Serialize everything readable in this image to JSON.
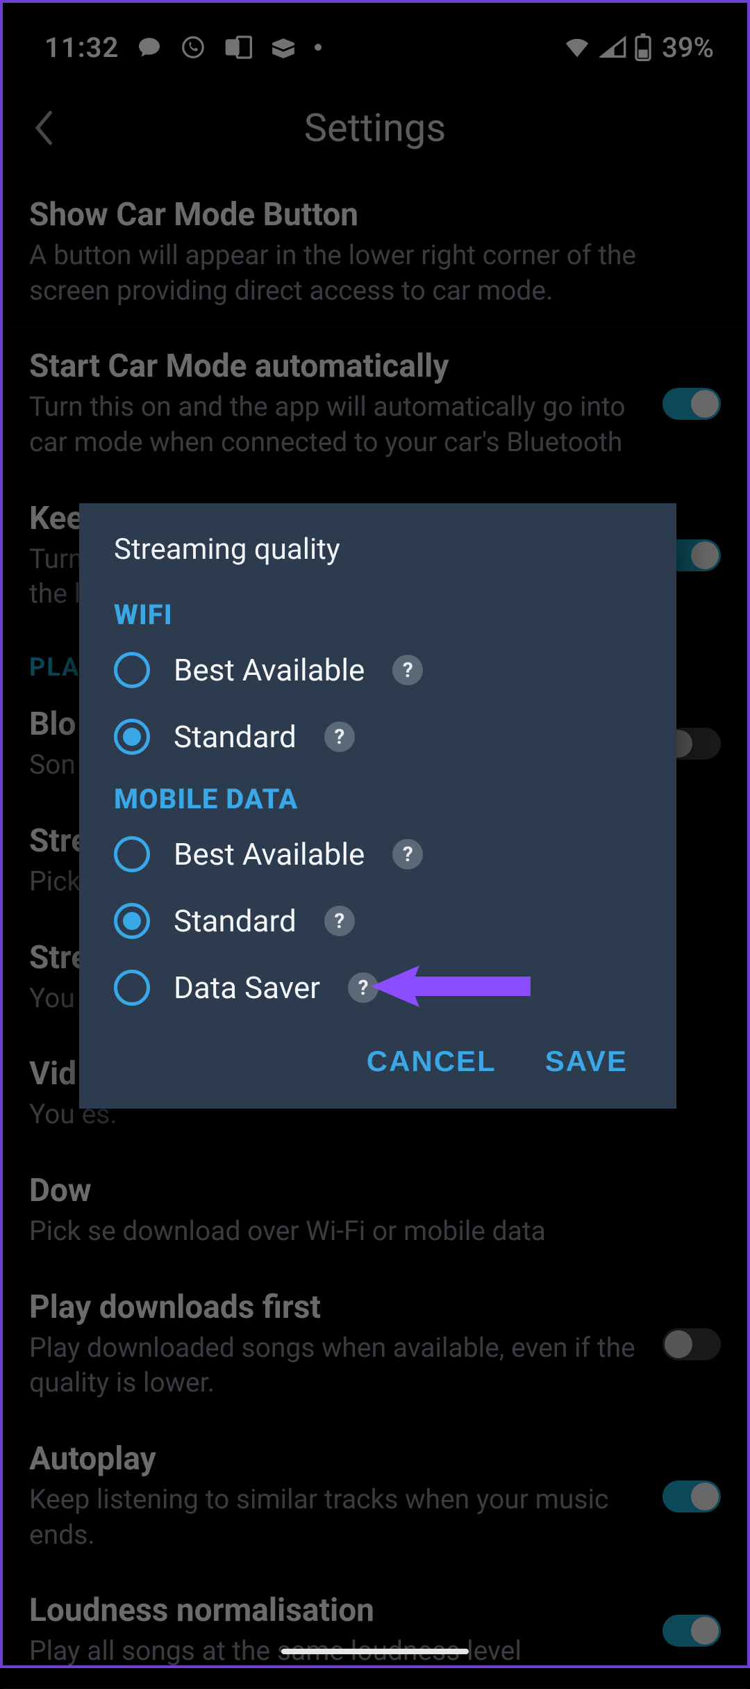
{
  "status": {
    "time": "11:32",
    "battery_text": "39%"
  },
  "header": {
    "title": "Settings"
  },
  "settings": [
    {
      "key": "car-mode-button",
      "title": "Show Car Mode Button",
      "sub": "A button will appear in the lower right corner of the screen providing direct access to car mode.",
      "toggle": null
    },
    {
      "key": "car-mode-auto",
      "title": "Start Car Mode automatically",
      "sub": "Turn this on and the app will automatically go into car mode when connected to your car's Bluetooth",
      "toggle": true
    },
    {
      "key": "keep-screen",
      "title": "Keep screen active",
      "sub": "Turning this on will keep the phone from going to the lock",
      "toggle": true
    },
    {
      "key": "block-explicit",
      "title": "Blo",
      "sub": "Son\ndevi",
      "toggle": false
    },
    {
      "key": "streaming-quality",
      "title": "Stre",
      "sub": "Pick                                                                                               ata",
      "toggle": null
    },
    {
      "key": "stream-only-wifi",
      "title": "Stre",
      "sub": "You",
      "toggle": null
    },
    {
      "key": "video-playback",
      "title": "Vid",
      "sub": "You                                                                                               es.",
      "toggle": null
    },
    {
      "key": "download-quality",
      "title": "Dow",
      "sub": "Pick                                                                                                 se download over Wi-Fi or mobile data",
      "toggle": null
    },
    {
      "key": "play-downloads-first",
      "title": "Play downloads first",
      "sub": "Play downloaded songs when available, even if the quality is lower.",
      "toggle": false
    },
    {
      "key": "autoplay",
      "title": "Autoplay",
      "sub": "Keep listening to similar tracks when your music ends.",
      "toggle": true
    },
    {
      "key": "loudness",
      "title": "Loudness normalisation",
      "sub": "Play all songs at the same loudness level",
      "toggle": true
    }
  ],
  "section_label": "PLA",
  "dialog": {
    "title": "Streaming quality",
    "wifi_label": "WIFI",
    "mobile_label": "MOBILE DATA",
    "wifi_options": [
      {
        "label": "Best Available",
        "selected": false
      },
      {
        "label": "Standard",
        "selected": true
      }
    ],
    "mobile_options": [
      {
        "label": "Best Available",
        "selected": false
      },
      {
        "label": "Standard",
        "selected": true
      },
      {
        "label": "Data Saver",
        "selected": false
      }
    ],
    "cancel": "CANCEL",
    "save": "SAVE",
    "help_glyph": "?"
  }
}
